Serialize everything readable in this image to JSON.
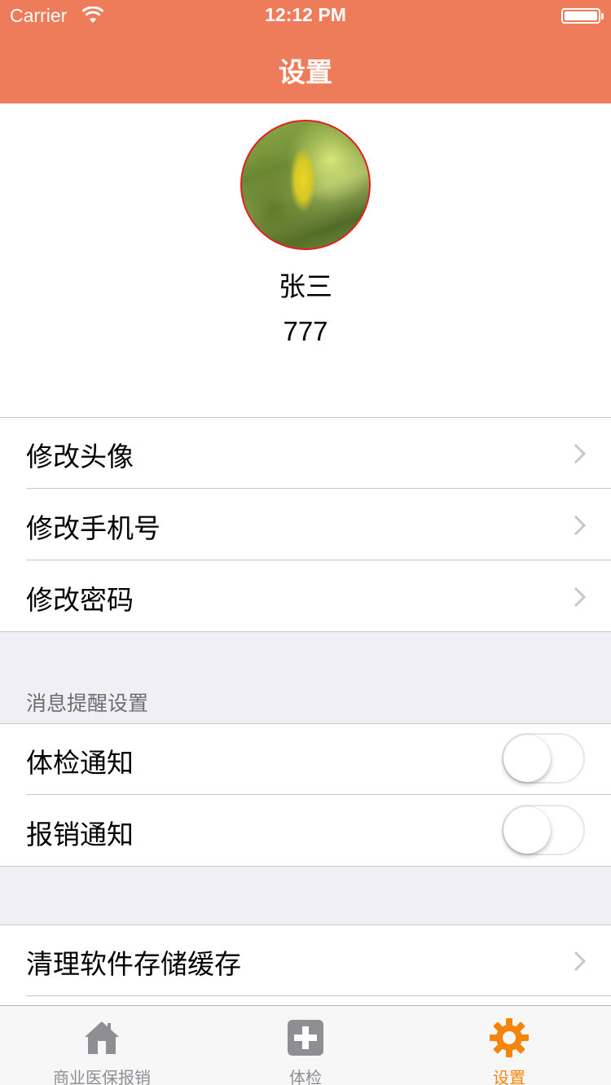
{
  "status_bar": {
    "carrier": "Carrier",
    "time": "12:12 PM"
  },
  "nav": {
    "title": "设置"
  },
  "profile": {
    "name": "张三",
    "id": "777"
  },
  "menu": {
    "change_avatar": "修改头像",
    "change_phone": "修改手机号",
    "change_password": "修改密码"
  },
  "notifications": {
    "header": "消息提醒设置",
    "items": [
      {
        "label": "体检通知",
        "enabled": false
      },
      {
        "label": "报销通知",
        "enabled": false
      }
    ]
  },
  "storage": {
    "clear_cache": "清理软件存储缓存"
  },
  "tabs": [
    {
      "label": "商业医保报销",
      "icon": "home-icon",
      "active": false
    },
    {
      "label": "体检",
      "icon": "plus-box-icon",
      "active": false
    },
    {
      "label": "设置",
      "icon": "gear-icon",
      "active": true
    }
  ],
  "colors": {
    "nav_bg": "#EE7B5A",
    "active_tab": "#F5850A",
    "inactive_tab": "#8E8E93"
  }
}
